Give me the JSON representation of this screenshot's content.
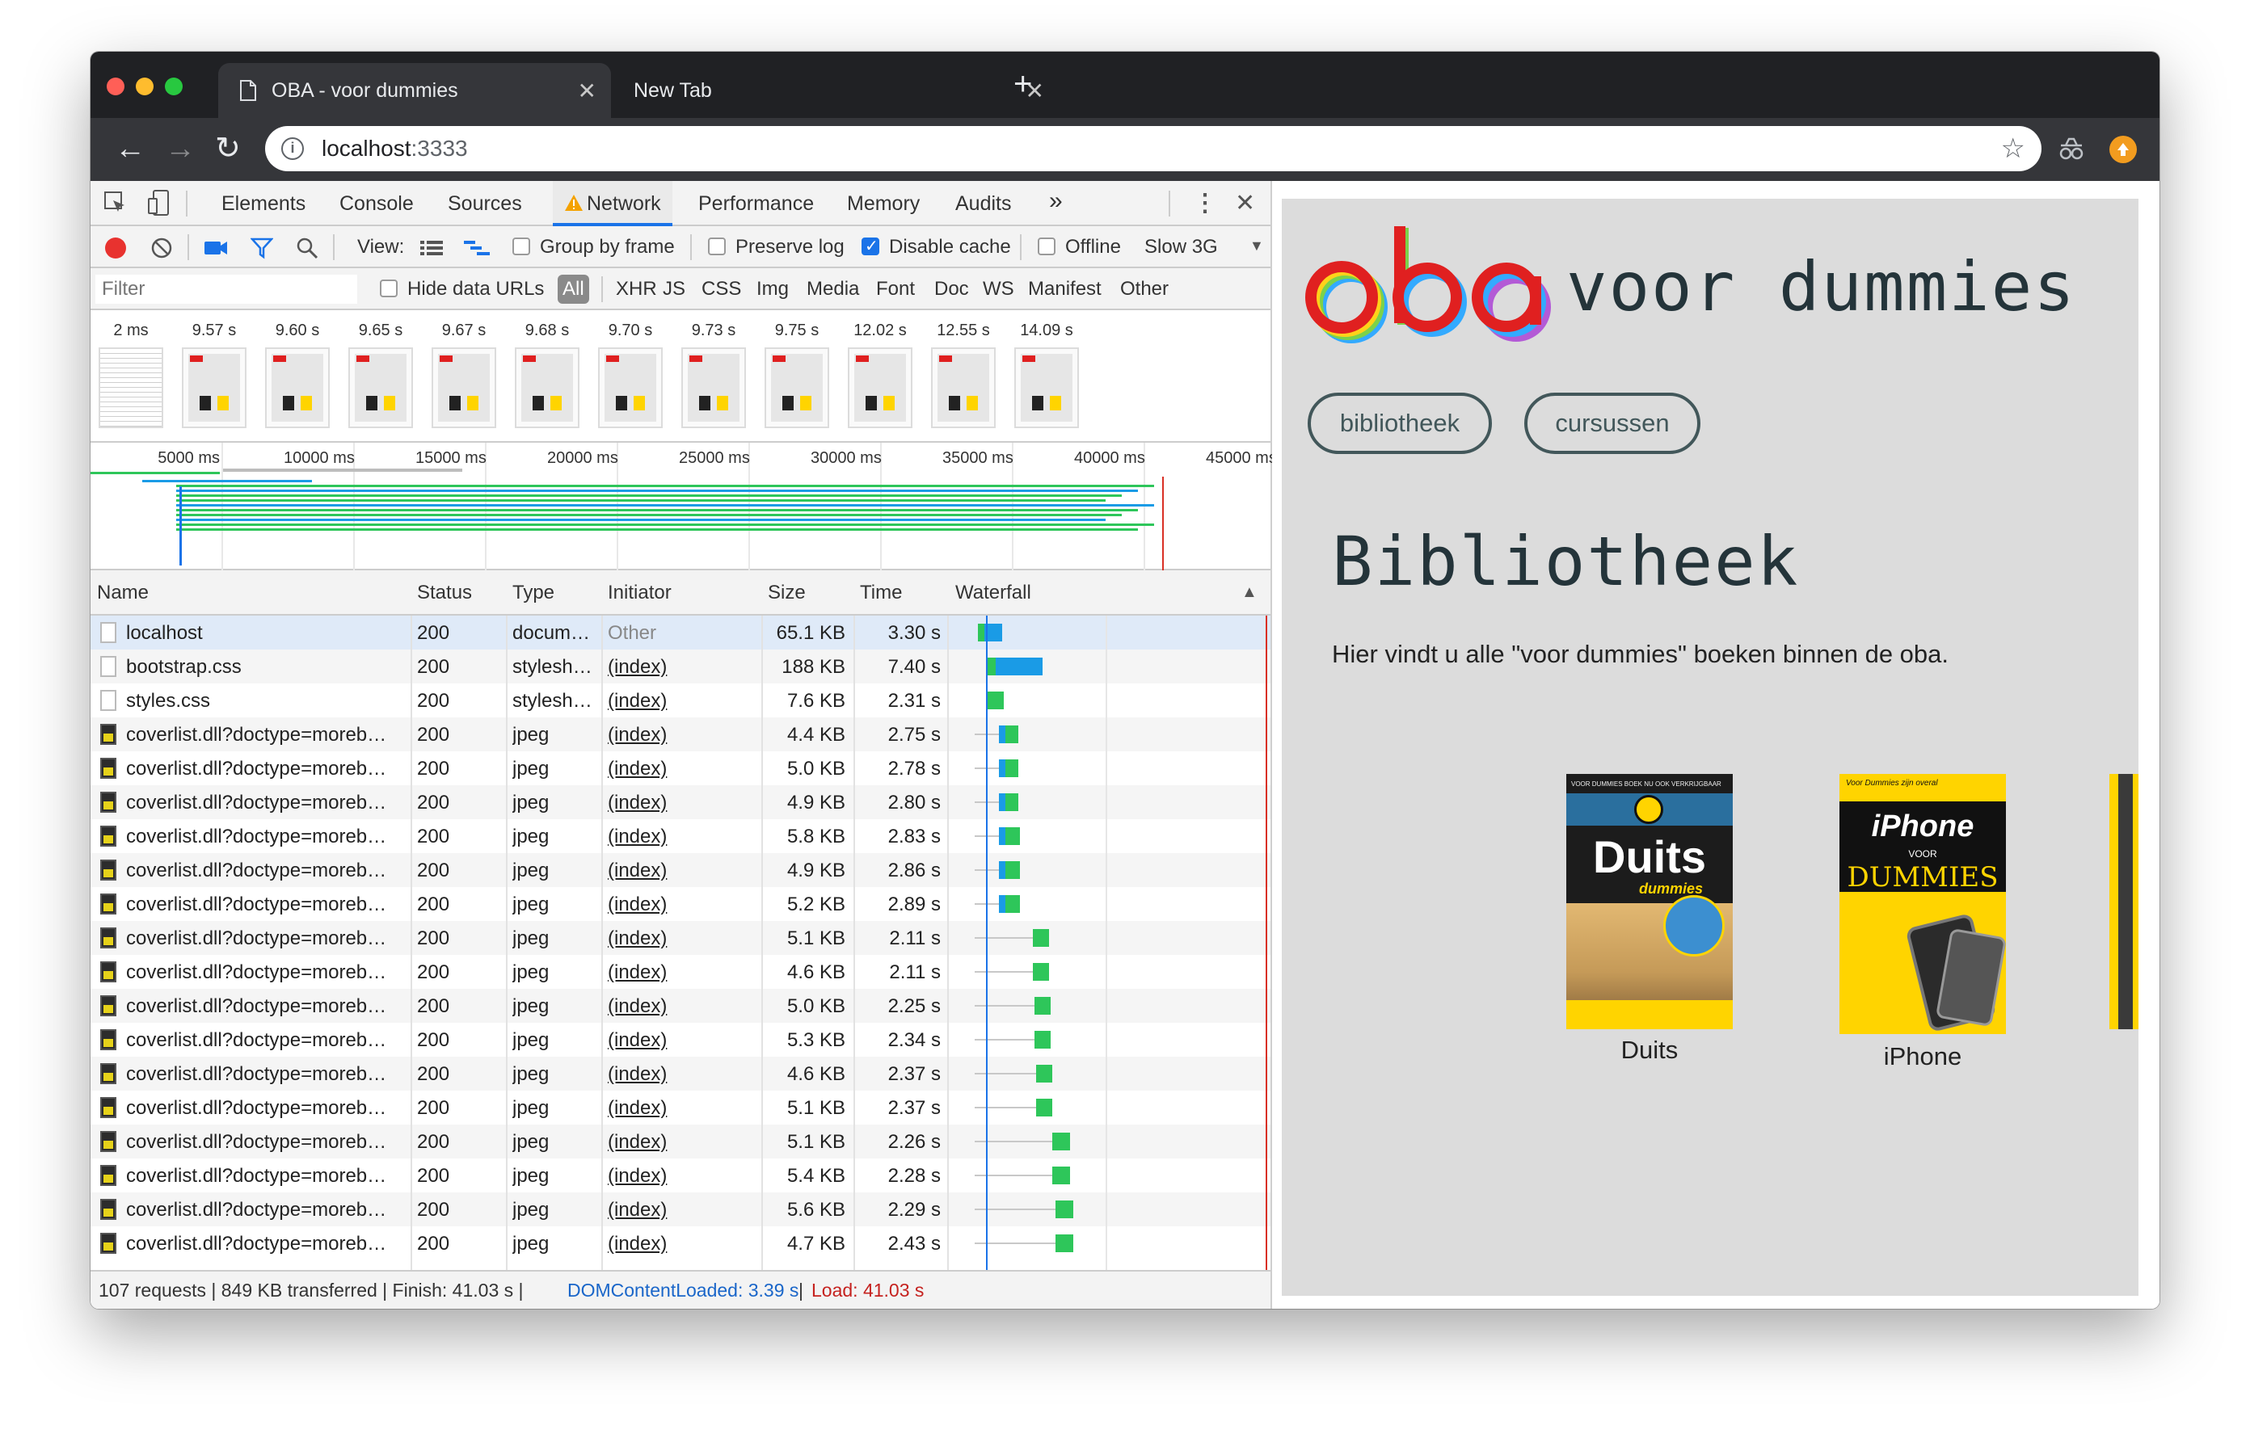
{
  "browser": {
    "tabs": [
      {
        "title": "OBA - voor dummies",
        "active": true
      },
      {
        "title": "New Tab",
        "active": false
      }
    ],
    "new_tab_symbol": "+",
    "address": {
      "host": "localhost",
      "port": ":3333"
    },
    "icons": [
      "back-arrow-icon",
      "forward-arrow-icon",
      "reload-icon",
      "info-icon",
      "star-icon",
      "extension-icon",
      "profile-icon"
    ]
  },
  "devtools": {
    "tabs": [
      "Elements",
      "Console",
      "Sources",
      "Network",
      "Performance",
      "Memory",
      "Audits"
    ],
    "active_tab": "Network",
    "more_tabs": "»",
    "toolbar": {
      "view_label": "View:",
      "group_by_frame": "Group by frame",
      "preserve_log": "Preserve log",
      "disable_cache": "Disable cache",
      "offline": "Offline",
      "throttle": "Slow 3G"
    },
    "filter": {
      "placeholder": "Filter",
      "hide_data_urls": "Hide data URLs",
      "types": [
        "All",
        "XHR",
        "JS",
        "CSS",
        "Img",
        "Media",
        "Font",
        "Doc",
        "WS",
        "Manifest",
        "Other"
      ]
    },
    "filmstrip_times": [
      "2 ms",
      "9.57 s",
      "9.60 s",
      "9.65 s",
      "9.67 s",
      "9.68 s",
      "9.70 s",
      "9.73 s",
      "9.75 s",
      "12.02 s",
      "12.55 s",
      "14.09 s"
    ],
    "overview_labels": [
      "5000 ms",
      "10000 ms",
      "15000 ms",
      "20000 ms",
      "25000 ms",
      "30000 ms",
      "35000 ms",
      "40000 ms",
      "45000 ms"
    ],
    "columns": [
      "Name",
      "Status",
      "Type",
      "Initiator",
      "Size",
      "Time",
      "Waterfall"
    ],
    "sort_indicator": "▲",
    "rows": [
      {
        "name": "localhost",
        "status": "200",
        "type": "docum…",
        "initiator": "Other",
        "size": "65.1 KB",
        "time": "3.30 s"
      },
      {
        "name": "bootstrap.css",
        "status": "200",
        "type": "stylesh…",
        "initiator": "(index)",
        "size": "188 KB",
        "time": "7.40 s"
      },
      {
        "name": "styles.css",
        "status": "200",
        "type": "stylesh…",
        "initiator": "(index)",
        "size": "7.6 KB",
        "time": "2.31 s"
      },
      {
        "name": "coverlist.dll?doctype=moreb…",
        "status": "200",
        "type": "jpeg",
        "initiator": "(index)",
        "size": "4.4 KB",
        "time": "2.75 s"
      },
      {
        "name": "coverlist.dll?doctype=moreb…",
        "status": "200",
        "type": "jpeg",
        "initiator": "(index)",
        "size": "5.0 KB",
        "time": "2.78 s"
      },
      {
        "name": "coverlist.dll?doctype=moreb…",
        "status": "200",
        "type": "jpeg",
        "initiator": "(index)",
        "size": "4.9 KB",
        "time": "2.80 s"
      },
      {
        "name": "coverlist.dll?doctype=moreb…",
        "status": "200",
        "type": "jpeg",
        "initiator": "(index)",
        "size": "5.8 KB",
        "time": "2.83 s"
      },
      {
        "name": "coverlist.dll?doctype=moreb…",
        "status": "200",
        "type": "jpeg",
        "initiator": "(index)",
        "size": "4.9 KB",
        "time": "2.86 s"
      },
      {
        "name": "coverlist.dll?doctype=moreb…",
        "status": "200",
        "type": "jpeg",
        "initiator": "(index)",
        "size": "5.2 KB",
        "time": "2.89 s"
      },
      {
        "name": "coverlist.dll?doctype=moreb…",
        "status": "200",
        "type": "jpeg",
        "initiator": "(index)",
        "size": "5.1 KB",
        "time": "2.11 s"
      },
      {
        "name": "coverlist.dll?doctype=moreb…",
        "status": "200",
        "type": "jpeg",
        "initiator": "(index)",
        "size": "4.6 KB",
        "time": "2.11 s"
      },
      {
        "name": "coverlist.dll?doctype=moreb…",
        "status": "200",
        "type": "jpeg",
        "initiator": "(index)",
        "size": "5.0 KB",
        "time": "2.25 s"
      },
      {
        "name": "coverlist.dll?doctype=moreb…",
        "status": "200",
        "type": "jpeg",
        "initiator": "(index)",
        "size": "5.3 KB",
        "time": "2.34 s"
      },
      {
        "name": "coverlist.dll?doctype=moreb…",
        "status": "200",
        "type": "jpeg",
        "initiator": "(index)",
        "size": "4.6 KB",
        "time": "2.37 s"
      },
      {
        "name": "coverlist.dll?doctype=moreb…",
        "status": "200",
        "type": "jpeg",
        "initiator": "(index)",
        "size": "5.1 KB",
        "time": "2.37 s"
      },
      {
        "name": "coverlist.dll?doctype=moreb…",
        "status": "200",
        "type": "jpeg",
        "initiator": "(index)",
        "size": "5.1 KB",
        "time": "2.26 s"
      },
      {
        "name": "coverlist.dll?doctype=moreb…",
        "status": "200",
        "type": "jpeg",
        "initiator": "(index)",
        "size": "5.4 KB",
        "time": "2.28 s"
      },
      {
        "name": "coverlist.dll?doctype=moreb…",
        "status": "200",
        "type": "jpeg",
        "initiator": "(index)",
        "size": "5.6 KB",
        "time": "2.29 s"
      },
      {
        "name": "coverlist.dll?doctype=moreb…",
        "status": "200",
        "type": "jpeg",
        "initiator": "(index)",
        "size": "4.7 KB",
        "time": "2.43 s"
      }
    ],
    "status": {
      "summary": "107 requests | 849 KB transferred | Finish: 41.03 s |",
      "dom_loaded": "DOMContentLoaded: 3.39 s",
      "divider": "|",
      "load": "Load: 41.03 s"
    },
    "colors": {
      "waiting": "#2ec65a",
      "download": "#1a9be6",
      "dom_line": "#1a73e8",
      "load_line": "#d93025",
      "record": "#e8322f"
    }
  },
  "page": {
    "logo_text": "oba",
    "title_suffix": "voor dummies",
    "nav": [
      "bibliotheek",
      "cursussen"
    ],
    "heading": "Bibliotheek",
    "intro": "Hier vindt u alle \"voor dummies\" boeken binnen de oba.",
    "books": [
      {
        "caption": "Duits",
        "cover_title": "Duits",
        "cover_sub": "dummies",
        "cover_top": "VOOR DUMMIES BOEK NU OOK VERKRIJGBAAR"
      },
      {
        "caption": "iPhone",
        "cover_title": "iPhone",
        "cover_sub": "DUMMIES",
        "cover_voor": "VOOR",
        "cover_top": "Voor Dummies zijn overal"
      }
    ]
  }
}
